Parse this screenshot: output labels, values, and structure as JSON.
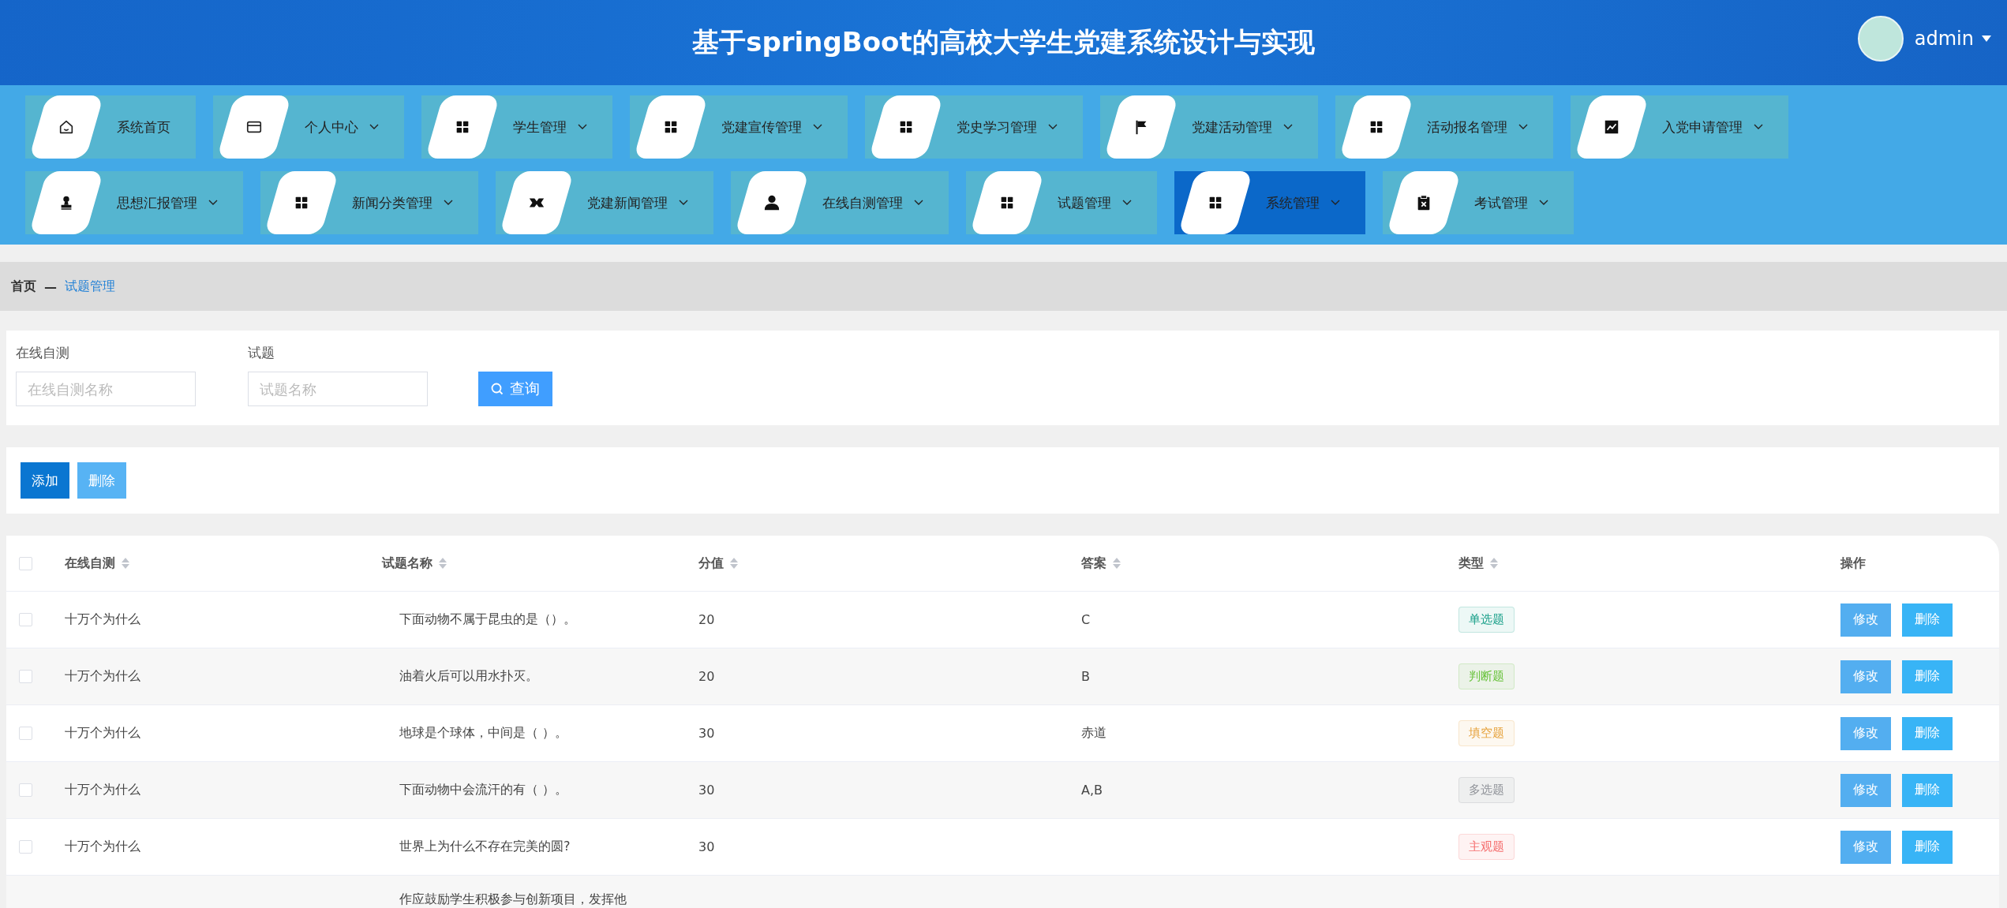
{
  "header": {
    "title": "基于springBoot的高校大学生党建系统设计与实现",
    "user": {
      "name": "admin"
    }
  },
  "nav": [
    {
      "label": "系统首页",
      "kind": "home",
      "dropdown": false,
      "selected": false
    },
    {
      "label": "个人中心",
      "kind": "card",
      "dropdown": true,
      "selected": false
    },
    {
      "label": "学生管理",
      "kind": "grid",
      "dropdown": true,
      "selected": false
    },
    {
      "label": "党建宣传管理",
      "kind": "grid",
      "dropdown": true,
      "selected": false
    },
    {
      "label": "党史学习管理",
      "kind": "grid",
      "dropdown": true,
      "selected": false
    },
    {
      "label": "党建活动管理",
      "kind": "flag",
      "dropdown": true,
      "selected": false
    },
    {
      "label": "活动报名管理",
      "kind": "grid",
      "dropdown": true,
      "selected": false
    },
    {
      "label": "入党申请管理",
      "kind": "chart",
      "dropdown": true,
      "selected": false
    },
    {
      "label": "思想汇报管理",
      "kind": "stamp",
      "dropdown": true,
      "selected": false
    },
    {
      "label": "新闻分类管理",
      "kind": "grid",
      "dropdown": true,
      "selected": false
    },
    {
      "label": "党建新闻管理",
      "kind": "bowtie",
      "dropdown": true,
      "selected": false
    },
    {
      "label": "在线自测管理",
      "kind": "user",
      "dropdown": true,
      "selected": false
    },
    {
      "label": "试题管理",
      "kind": "grid",
      "dropdown": true,
      "selected": false
    },
    {
      "label": "系统管理",
      "kind": "grid",
      "dropdown": true,
      "selected": true
    },
    {
      "label": "考试管理",
      "kind": "clipboard",
      "dropdown": true,
      "selected": false
    }
  ],
  "breadcrumb": {
    "home": "首页",
    "separator": "—",
    "current": "试题管理"
  },
  "search": {
    "fields": [
      {
        "label": "在线自测",
        "placeholder": "在线自测名称"
      },
      {
        "label": "试题",
        "placeholder": "试题名称"
      }
    ],
    "button": "查询"
  },
  "actions": [
    {
      "label": "添加",
      "disabled": false
    },
    {
      "label": "删除",
      "disabled": true
    }
  ],
  "table": {
    "select_all": {
      "checked": false
    },
    "columns": [
      {
        "label": "在线自测",
        "sortable": true
      },
      {
        "label": "试题名称",
        "sortable": true
      },
      {
        "label": "分值",
        "sortable": true
      },
      {
        "label": "答案",
        "sortable": true
      },
      {
        "label": "类型",
        "sortable": true
      },
      {
        "label": "操作",
        "sortable": false
      }
    ],
    "rows": [
      {
        "checked": false,
        "test": "十万个为什么",
        "question": "下面动物不属于昆虫的是（）。",
        "score": "20",
        "answer": "C",
        "type": {
          "label": "单选题",
          "color": "#1aa08a"
        },
        "actions": [
          "修改",
          "删除"
        ]
      },
      {
        "checked": false,
        "test": "十万个为什么",
        "question": "油着火后可以用水扑灭。",
        "score": "20",
        "answer": "B",
        "type": {
          "label": "判断题",
          "color": "#67c23a"
        },
        "actions": [
          "修改",
          "删除"
        ]
      },
      {
        "checked": false,
        "test": "十万个为什么",
        "question": "地球是个球体，中间是（ ）。",
        "score": "30",
        "answer": "赤道",
        "type": {
          "label": "填空题",
          "color": "#e6a23c"
        },
        "actions": [
          "修改",
          "删除"
        ]
      },
      {
        "checked": false,
        "test": "十万个为什么",
        "question": "下面动物中会流汗的有（ ）。",
        "score": "30",
        "answer": "A,B",
        "type": {
          "label": "多选题",
          "color": "#909399"
        },
        "actions": [
          "修改",
          "删除"
        ]
      },
      {
        "checked": false,
        "test": "十万个为什么",
        "question": "世界上为什么不存在完美的圆?",
        "score": "30",
        "type": {
          "label": "主观题",
          "color": "#f56c6c"
        },
        "actions": [
          "修改",
          "删除"
        ]
      },
      {
        "question": "作应鼓励学生积极参与创新项目，发挥他"
      }
    ]
  }
}
